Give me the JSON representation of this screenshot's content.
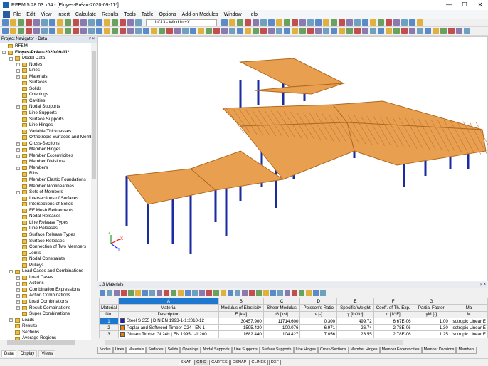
{
  "window": {
    "title": "RFEM 5.28.03 x64 - [Eloyes-Préau-2020-09-11*]",
    "min": "—",
    "max": "☐",
    "close": "✕"
  },
  "menu": [
    "File",
    "Edit",
    "View",
    "Insert",
    "Calculate",
    "Results",
    "Tools",
    "Table",
    "Options",
    "Add-on Modules",
    "Window",
    "Help"
  ],
  "toolbar": {
    "load_case": "LC13 - Wind in +X"
  },
  "navigator": {
    "title": "Project Navigator - Data",
    "pin": "ᵖ ×",
    "tree": [
      {
        "l": 0,
        "t": "RFEM",
        "e": 0
      },
      {
        "l": 0,
        "t": "Eloyes-Préau-2020-09-11*",
        "e": 1,
        "b": 1
      },
      {
        "l": 1,
        "t": "Model Data",
        "e": 1
      },
      {
        "l": 2,
        "t": "Nodes",
        "e": 1
      },
      {
        "l": 2,
        "t": "Lines",
        "e": 1
      },
      {
        "l": 2,
        "t": "Materials",
        "e": 1
      },
      {
        "l": 2,
        "t": "Surfaces",
        "e": 0
      },
      {
        "l": 2,
        "t": "Solids",
        "e": 0
      },
      {
        "l": 2,
        "t": "Openings",
        "e": 0
      },
      {
        "l": 2,
        "t": "Cavities",
        "e": 0
      },
      {
        "l": 2,
        "t": "Nodal Supports",
        "e": 1
      },
      {
        "l": 2,
        "t": "Line Supports",
        "e": 0
      },
      {
        "l": 2,
        "t": "Surface Supports",
        "e": 0
      },
      {
        "l": 2,
        "t": "Line Hinges",
        "e": 0
      },
      {
        "l": 2,
        "t": "Variable Thicknesses",
        "e": 0
      },
      {
        "l": 2,
        "t": "Orthotropic Surfaces and Membra",
        "e": 0
      },
      {
        "l": 2,
        "t": "Cross-Sections",
        "e": 1
      },
      {
        "l": 2,
        "t": "Member Hinges",
        "e": 1
      },
      {
        "l": 2,
        "t": "Member Eccentricities",
        "e": 1
      },
      {
        "l": 2,
        "t": "Member Divisions",
        "e": 0
      },
      {
        "l": 2,
        "t": "Members",
        "e": 1
      },
      {
        "l": 2,
        "t": "Ribs",
        "e": 0
      },
      {
        "l": 2,
        "t": "Member Elastic Foundations",
        "e": 0
      },
      {
        "l": 2,
        "t": "Member Nonlinearities",
        "e": 0
      },
      {
        "l": 2,
        "t": "Sets of Members",
        "e": 1
      },
      {
        "l": 2,
        "t": "Intersections of Surfaces",
        "e": 0
      },
      {
        "l": 2,
        "t": "Intersections of Solids",
        "e": 0
      },
      {
        "l": 2,
        "t": "FE Mesh Refinements",
        "e": 0
      },
      {
        "l": 2,
        "t": "Nodal Releases",
        "e": 0
      },
      {
        "l": 2,
        "t": "Line Release Types",
        "e": 0
      },
      {
        "l": 2,
        "t": "Line Releases",
        "e": 0
      },
      {
        "l": 2,
        "t": "Surface Release Types",
        "e": 0
      },
      {
        "l": 2,
        "t": "Surface Releases",
        "e": 0
      },
      {
        "l": 2,
        "t": "Connection of Two Members",
        "e": 0
      },
      {
        "l": 2,
        "t": "Joints",
        "e": 0
      },
      {
        "l": 2,
        "t": "Nodal Constraints",
        "e": 0
      },
      {
        "l": 2,
        "t": "Pulleys",
        "e": 0
      },
      {
        "l": 1,
        "t": "Load Cases and Combinations",
        "e": 1
      },
      {
        "l": 2,
        "t": "Load Cases",
        "e": 1
      },
      {
        "l": 2,
        "t": "Actions",
        "e": 1
      },
      {
        "l": 2,
        "t": "Combination Expressions",
        "e": 1
      },
      {
        "l": 2,
        "t": "Action Combinations",
        "e": 1
      },
      {
        "l": 2,
        "t": "Load Combinations",
        "e": 1
      },
      {
        "l": 2,
        "t": "Result Combinations",
        "e": 1
      },
      {
        "l": 2,
        "t": "Super Combinations",
        "e": 0
      },
      {
        "l": 1,
        "t": "Loads",
        "e": 1
      },
      {
        "l": 1,
        "t": "Results",
        "e": 0
      },
      {
        "l": 1,
        "t": "Sections",
        "e": 0
      },
      {
        "l": 1,
        "t": "Average Regions",
        "e": 0
      }
    ],
    "tabs": [
      "Data",
      "Display",
      "Views"
    ]
  },
  "table_panel": {
    "title": "1.3 Materials",
    "pin": "ᵖ ×",
    "col_letters": [
      "A",
      "B",
      "C",
      "D",
      "E",
      "F",
      "G",
      ""
    ],
    "headers1": [
      "Material",
      "Material",
      "Modulus of Elasticity",
      "Shear Modulus",
      "Poisson's Ratio",
      "Specific Weight",
      "Coeff. of Th. Exp.",
      "Partial Factor",
      "Ma"
    ],
    "headers2": [
      "No.",
      "Description",
      "E [ksi]",
      "G [ksi]",
      "ν [-]",
      "γ [lbf/ft³]",
      "α [1/°F]",
      "γM [-]",
      "M"
    ],
    "rows": [
      {
        "no": "1",
        "color": "#1a1ad0",
        "desc": "Steel S 355 | DIN EN 1993-1-1:2010-12",
        "E": "30457.900",
        "G": "11714.600",
        "nu": "0.300",
        "gamma": "499.72",
        "alpha": "6.67E-06",
        "gm": "1.00",
        "model": "Isotropic Linear E"
      },
      {
        "no": "2",
        "color": "#e88010",
        "desc": "Poplar and Softwood Timber C24 | EN 1",
        "E": "1595.420",
        "G": "100.076",
        "nu": "6.971",
        "gamma": "26.74",
        "alpha": "2.78E-06",
        "gm": "1.30",
        "model": "Isotropic Linear E"
      },
      {
        "no": "3",
        "color": "#e88010",
        "desc": "Glulam Timber GL24h | EN 1995-1-1:200",
        "E": "1682.440",
        "G": "104.427",
        "nu": "7.056",
        "gamma": "23.55",
        "alpha": "2.78E-06",
        "gm": "1.25",
        "model": "Isotropic Linear E"
      }
    ],
    "tabs": [
      "Nodes",
      "Lines",
      "Materials",
      "Surfaces",
      "Solids",
      "Openings",
      "Nodal Supports",
      "Line Supports",
      "Surface Supports",
      "Line Hinges",
      "Cross-Sections",
      "Member Hinges",
      "Member Eccentricities",
      "Member Divisions",
      "Members"
    ]
  },
  "statusbar": [
    "SNAP",
    "GRID",
    "CARTES",
    "OSNAP",
    "GLINES",
    "DXF"
  ],
  "axes": {
    "x": "X",
    "y": "Y",
    "z": "Z"
  },
  "colors": {
    "timber": "#e8a050",
    "steel": "#1a2aa0",
    "selection": "#1e78d0"
  }
}
